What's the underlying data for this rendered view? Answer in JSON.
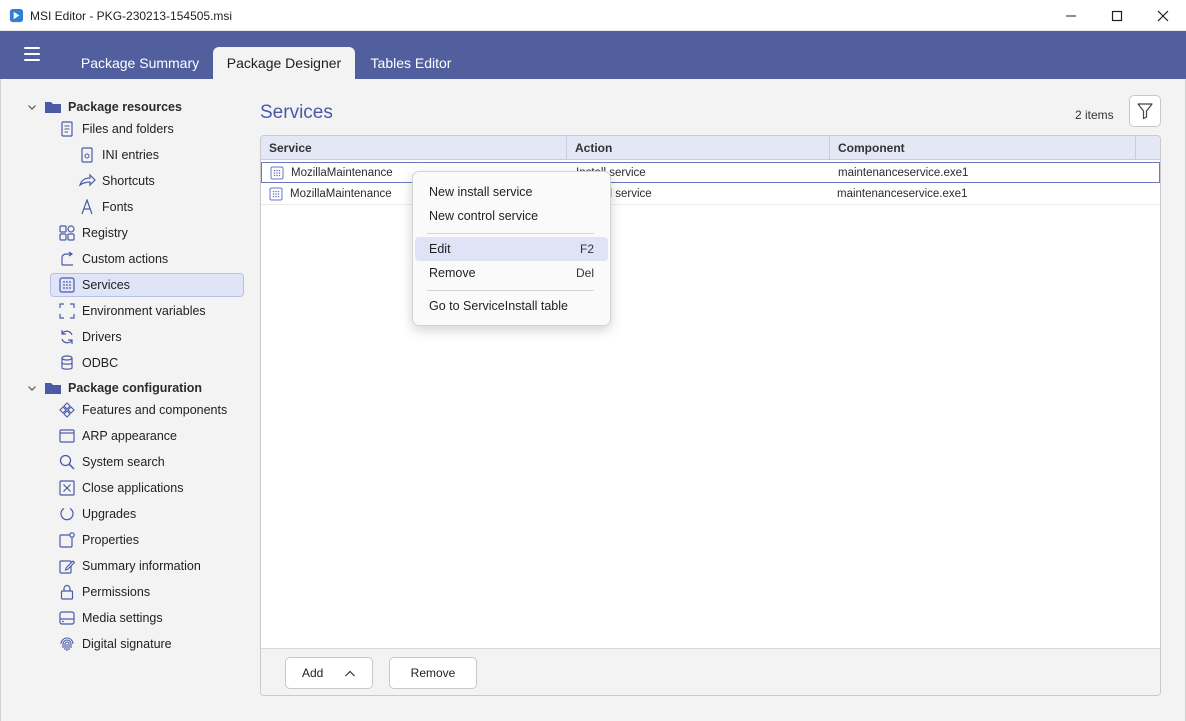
{
  "window": {
    "title": "MSI Editor - PKG-230213-154505.msi"
  },
  "tabs": [
    {
      "label": "Package Summary"
    },
    {
      "label": "Package Designer"
    },
    {
      "label": "Tables Editor"
    }
  ],
  "sidebar": {
    "groups": [
      {
        "label": "Package resources",
        "items": [
          {
            "label": "Files and folders"
          },
          {
            "label": "INI entries"
          },
          {
            "label": "Shortcuts"
          },
          {
            "label": "Fonts"
          },
          {
            "label": "Registry"
          },
          {
            "label": "Custom actions"
          },
          {
            "label": "Services"
          },
          {
            "label": "Environment variables"
          },
          {
            "label": "Drivers"
          },
          {
            "label": "ODBC"
          }
        ]
      },
      {
        "label": "Package configuration",
        "items": [
          {
            "label": "Features and components"
          },
          {
            "label": "ARP appearance"
          },
          {
            "label": "System search"
          },
          {
            "label": "Close applications"
          },
          {
            "label": "Upgrades"
          },
          {
            "label": "Properties"
          },
          {
            "label": "Summary information"
          },
          {
            "label": "Permissions"
          },
          {
            "label": "Media settings"
          },
          {
            "label": "Digital signature"
          }
        ]
      }
    ],
    "selected": "Services"
  },
  "main": {
    "title": "Services",
    "count": "2 items",
    "columns": [
      "Service",
      "Action",
      "Component"
    ],
    "rows": [
      {
        "service": "MozillaMaintenance",
        "action": "Install service",
        "component": "maintenanceservice.exe1"
      },
      {
        "service": "MozillaMaintenance",
        "action": "Control service",
        "component": "maintenanceservice.exe1"
      }
    ],
    "add_label": "Add",
    "remove_label": "Remove"
  },
  "context_menu": {
    "items": [
      {
        "label": "New install service",
        "shortcut": ""
      },
      {
        "label": "New control service",
        "shortcut": ""
      },
      {
        "label": "Edit",
        "shortcut": "F2"
      },
      {
        "label": "Remove",
        "shortcut": "Del"
      },
      {
        "label": "Go to ServiceInstall table",
        "shortcut": ""
      }
    ]
  },
  "colors": {
    "accent": "#515f9f",
    "title_text": "#4a5aa8",
    "selection": "#e0e4f7"
  }
}
